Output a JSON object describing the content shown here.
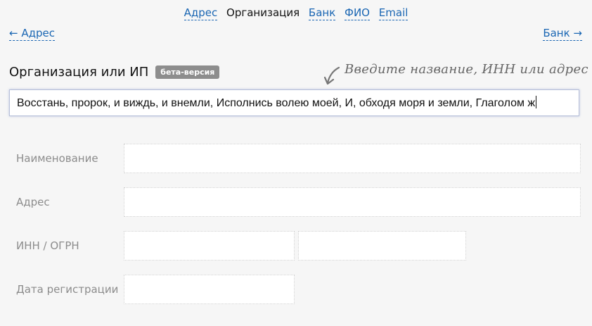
{
  "nav": {
    "address": "Адрес",
    "organization": "Организация",
    "bank": "Банк",
    "fio": "ФИО",
    "email": "Email"
  },
  "pager": {
    "prev": "← Адрес",
    "next": "Банк →"
  },
  "section": {
    "title": "Организация или ИП",
    "badge": "бета-версия",
    "hint": "Введите название, ИНН или адрес"
  },
  "search_input": {
    "value": "Восстань, пророк, и виждь, и внемли, Исполнись волею моей, И, обходя моря и земли, Глаголом ж"
  },
  "fields": {
    "name_label": "Наименование",
    "address_label": "Адрес",
    "inn_ogrn_label": "ИНН / ОГРН",
    "reg_date_label": "Дата регистрации"
  },
  "colors": {
    "link": "#1a66b3",
    "badge_bg": "#8d8d8d",
    "label": "#8c8c8c",
    "background": "#f6f6f6"
  }
}
